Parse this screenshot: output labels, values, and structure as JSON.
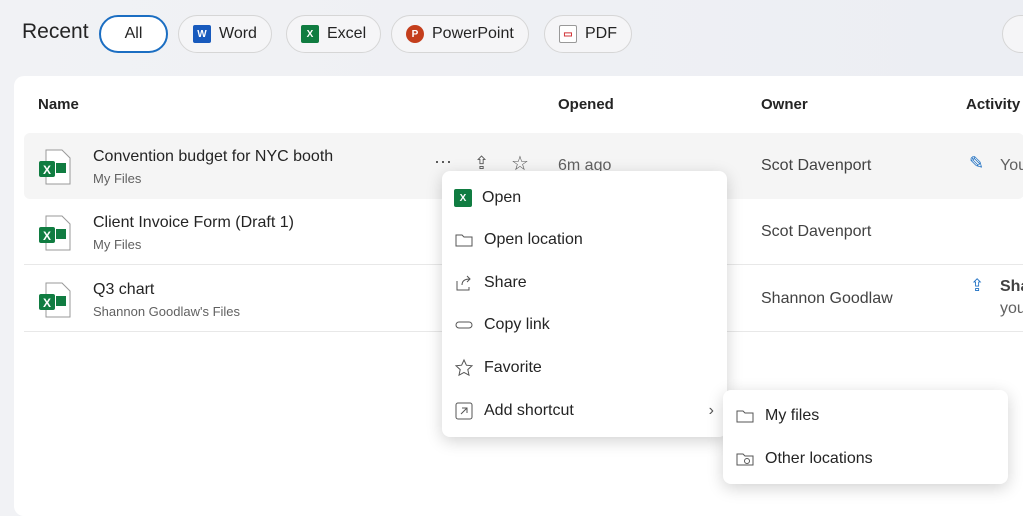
{
  "header": {
    "title": "Recent",
    "filters": [
      {
        "label": "All",
        "active": true
      },
      {
        "label": "Word",
        "icon": "word-icon",
        "color": "#185abd"
      },
      {
        "label": "Excel",
        "icon": "excel-icon",
        "color": "#107c41"
      },
      {
        "label": "PowerPoint",
        "icon": "powerpoint-icon",
        "color": "#c43e1c"
      },
      {
        "label": "PDF",
        "icon": "pdf-icon",
        "color": "#d13438"
      }
    ]
  },
  "table": {
    "columns": [
      "Name",
      "Opened",
      "Owner",
      "Activity"
    ],
    "rows": [
      {
        "name": "Convention budget for NYC booth",
        "location": "My Files",
        "opened": "6m ago",
        "owner": "Scot Davenport",
        "activity": "You"
      },
      {
        "name": "Client Invoice Form (Draft 1)",
        "location": "My Files",
        "opened": "",
        "owner": "Scot Davenport",
        "activity": ""
      },
      {
        "name": "Q3 chart",
        "location": "Shannon Goodlaw's Files",
        "opened": "",
        "owner": "Shannon Goodlaw",
        "activity": "Sha",
        "activity_sub": "you"
      }
    ]
  },
  "context_menu": {
    "items": [
      "Open",
      "Open location",
      "Share",
      "Copy link",
      "Favorite",
      "Add shortcut"
    ]
  },
  "submenu": {
    "items": [
      "My files",
      "Other locations"
    ]
  },
  "colors": {
    "accent": "#1b6ec2",
    "excel": "#107c41"
  }
}
